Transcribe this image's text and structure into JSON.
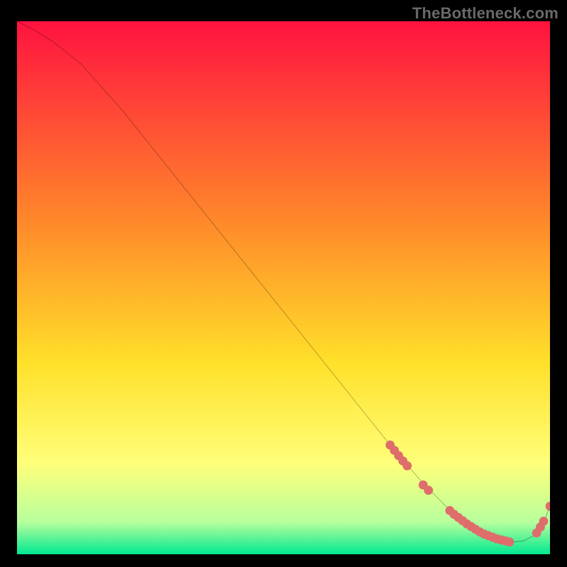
{
  "watermark": "TheBottleneck.com",
  "colors": {
    "page_bg": "#000000",
    "watermark": "#696969",
    "curve": "#000000",
    "dot": "#de6d6b",
    "grad_top": "#ff1240",
    "grad_mid_upper": "#ff8a2a",
    "grad_mid": "#ffe02a",
    "grad_low_yellow": "#ffff7a",
    "grad_near_bottom": "#b7ff9d",
    "grad_bottom": "#00e890"
  },
  "chart_data": {
    "type": "line",
    "title": "",
    "xlabel": "",
    "ylabel": "",
    "xlim": [
      0,
      100
    ],
    "ylim": [
      0,
      100
    ],
    "x": [
      0,
      3,
      7,
      12,
      20,
      30,
      40,
      50,
      60,
      66,
      70,
      73,
      76,
      79,
      81,
      83,
      85,
      87,
      89,
      91,
      93,
      95,
      97,
      99,
      100
    ],
    "y": [
      100,
      98.5,
      96,
      92,
      83,
      70.5,
      58,
      45.5,
      33,
      25.5,
      20.5,
      17,
      13.5,
      10.5,
      8.5,
      6.8,
      5.3,
      4.1,
      3.2,
      2.6,
      2.3,
      2.5,
      3.5,
      6.5,
      9
    ],
    "markers": [
      {
        "x": 70.0,
        "y": 20.5
      },
      {
        "x": 70.8,
        "y": 19.5
      },
      {
        "x": 71.6,
        "y": 18.5
      },
      {
        "x": 72.4,
        "y": 17.5
      },
      {
        "x": 73.2,
        "y": 16.6
      },
      {
        "x": 76.2,
        "y": 13.0
      },
      {
        "x": 77.2,
        "y": 12.0
      },
      {
        "x": 81.2,
        "y": 8.2
      },
      {
        "x": 82.0,
        "y": 7.5
      },
      {
        "x": 82.8,
        "y": 6.9
      },
      {
        "x": 83.6,
        "y": 6.3
      },
      {
        "x": 84.4,
        "y": 5.7
      },
      {
        "x": 85.2,
        "y": 5.2
      },
      {
        "x": 86.0,
        "y": 4.7
      },
      {
        "x": 86.8,
        "y": 4.2
      },
      {
        "x": 87.6,
        "y": 3.8
      },
      {
        "x": 88.4,
        "y": 3.5
      },
      {
        "x": 89.2,
        "y": 3.2
      },
      {
        "x": 90.0,
        "y": 2.9
      },
      {
        "x": 90.8,
        "y": 2.7
      },
      {
        "x": 91.6,
        "y": 2.5
      },
      {
        "x": 92.4,
        "y": 2.3
      },
      {
        "x": 97.5,
        "y": 4.0
      },
      {
        "x": 98.2,
        "y": 5.1
      },
      {
        "x": 98.8,
        "y": 6.2
      },
      {
        "x": 100.0,
        "y": 9.0
      }
    ]
  }
}
